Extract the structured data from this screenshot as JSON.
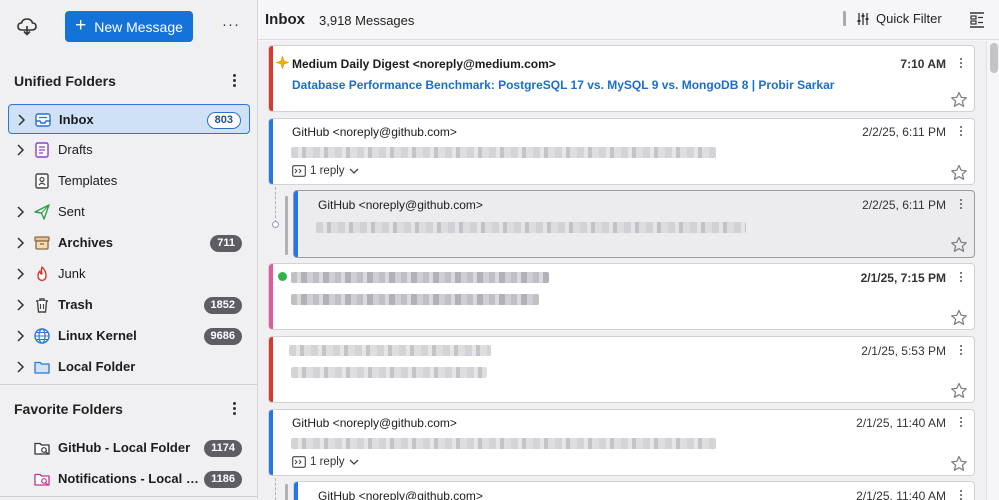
{
  "sidebar": {
    "new_message_label": "New Message",
    "unified_title": "Unified Folders",
    "favorite_title": "Favorite Folders",
    "folders": [
      {
        "name": "Inbox",
        "count": "803",
        "icon": "inbox-icon"
      },
      {
        "name": "Drafts",
        "count": "",
        "icon": "drafts-icon"
      },
      {
        "name": "Templates",
        "count": "",
        "icon": "templates-icon"
      },
      {
        "name": "Sent",
        "count": "",
        "icon": "sent-icon"
      },
      {
        "name": "Archives",
        "count": "711",
        "icon": "archives-icon"
      },
      {
        "name": "Junk",
        "count": "",
        "icon": "junk-icon"
      },
      {
        "name": "Trash",
        "count": "1852",
        "icon": "trash-icon"
      },
      {
        "name": "Linux Kernel",
        "count": "9686",
        "icon": "globe-icon"
      },
      {
        "name": "Local Folder",
        "count": "",
        "icon": "folder-icon"
      }
    ],
    "favorites": [
      {
        "name": "GitHub - Local Folder",
        "count": "1174",
        "icon": "search-folder-icon"
      },
      {
        "name": "Notifications - Local …",
        "count": "1186",
        "icon": "search-folder-icon"
      }
    ]
  },
  "toolbar": {
    "title": "Inbox",
    "count": "3,918 Messages",
    "quick_filter": "Quick Filter"
  },
  "messages": [
    {
      "sender": "Medium Daily Digest <noreply@medium.com>",
      "date": "7:10 AM",
      "subject": "Database Performance Benchmark: PostgreSQL 17 vs. MySQL 9 vs. MongoDB 8 | Probir Sarkar"
    },
    {
      "sender": "GitHub <noreply@github.com>",
      "date": "2/2/25, 6:11 PM",
      "reply": "1 reply"
    },
    {
      "sender": "GitHub <noreply@github.com>",
      "date": "2/2/25, 6:11 PM"
    },
    {
      "sender": "",
      "date": "2/1/25, 7:15 PM"
    },
    {
      "sender": "",
      "date": "2/1/25, 5:53 PM"
    },
    {
      "sender": "GitHub <noreply@github.com>",
      "date": "2/1/25, 11:40 AM",
      "reply": "1 reply"
    },
    {
      "sender": "GitHub <noreply@github.com>",
      "date": "2/1/25, 11:40 AM"
    }
  ],
  "colors": {
    "accent": "#1373d9",
    "stripe_red": "#d93a2f",
    "stripe_blue": "#2477e6",
    "stripe_pink": "#e05a9c",
    "unread_green": "#2fb34a"
  }
}
